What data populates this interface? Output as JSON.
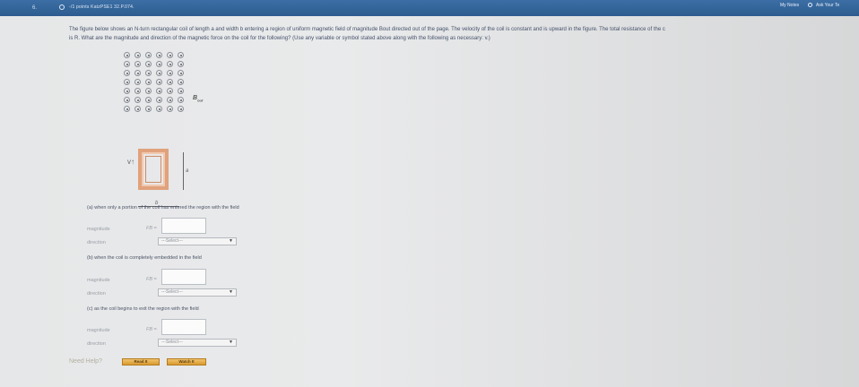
{
  "header": {
    "question_number": "6.",
    "meta": "-/1 points  KatzPSE1 32.P.074.",
    "notes_label": "My Notes",
    "ask_label": "Ask Your Te"
  },
  "problem": {
    "line1": "The figure below shows an N-turn rectangular coil of length a and width b entering a region of uniform magnetic field of magnitude Bout directed out of the page. The velocity of the coil is constant and is upward in the figure. The total resistance of the c",
    "line2": "is R. What are the magnitude and direction of the magnetic force on the coil for the following? (Use any variable or symbol stated above along with the following as necessary: v.)"
  },
  "figure": {
    "b_label": "B",
    "b_sub": "out",
    "a_label": "a",
    "b_dim_label": "b",
    "velocity_label": "v"
  },
  "parts": [
    {
      "prompt": "(a) when only a portion of the coil has entered the region with the field",
      "magnitude_label": "magnitude",
      "symbol": "FB =",
      "direction_label": "direction",
      "direction_value": "---Select---"
    },
    {
      "prompt": "(b) when the coil is completely embedded in the field",
      "magnitude_label": "magnitude",
      "symbol": "FB =",
      "direction_label": "direction",
      "direction_value": "---Select---"
    },
    {
      "prompt": "(c) as the coil begins to exit the region with the field",
      "magnitude_label": "magnitude",
      "symbol": "FB =",
      "direction_label": "direction",
      "direction_value": "---Select---"
    }
  ],
  "help": {
    "label": "Need Help?",
    "read_label": "Read It",
    "watch_label": "Watch It"
  },
  "colors": {
    "header_bar": "#2d5c8f",
    "coil": "#e0a27d",
    "button": "#d99a2f"
  }
}
